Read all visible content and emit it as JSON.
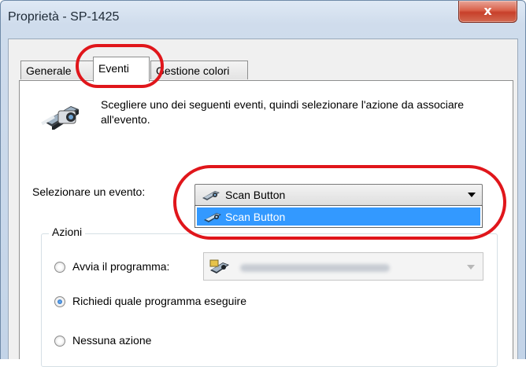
{
  "window": {
    "title": "Proprietà - SP-1425",
    "close_glyph": "x"
  },
  "tabs": [
    {
      "label": "Generale"
    },
    {
      "label": "Eventi"
    },
    {
      "label": "Gestione colori"
    }
  ],
  "description": "Scegliere uno dei seguenti eventi, quindi selezionare l'azione da associare all'evento.",
  "event": {
    "label": "Selezionare un evento:",
    "selected": "Scan Button",
    "options": [
      "Scan Button"
    ]
  },
  "actions": {
    "group_label": "Azioni",
    "start_program": "Avvia il programma:",
    "ask_program": "Richiedi quale programma eseguire",
    "no_action": "Nessuna azione",
    "selected_option": "ask_program"
  },
  "colors": {
    "annotation": "#e0161b",
    "highlight": "#3399ff"
  },
  "icons": [
    "scanner-icon",
    "scan-button-icon",
    "program-icon",
    "close-icon",
    "chevron-down-icon"
  ]
}
